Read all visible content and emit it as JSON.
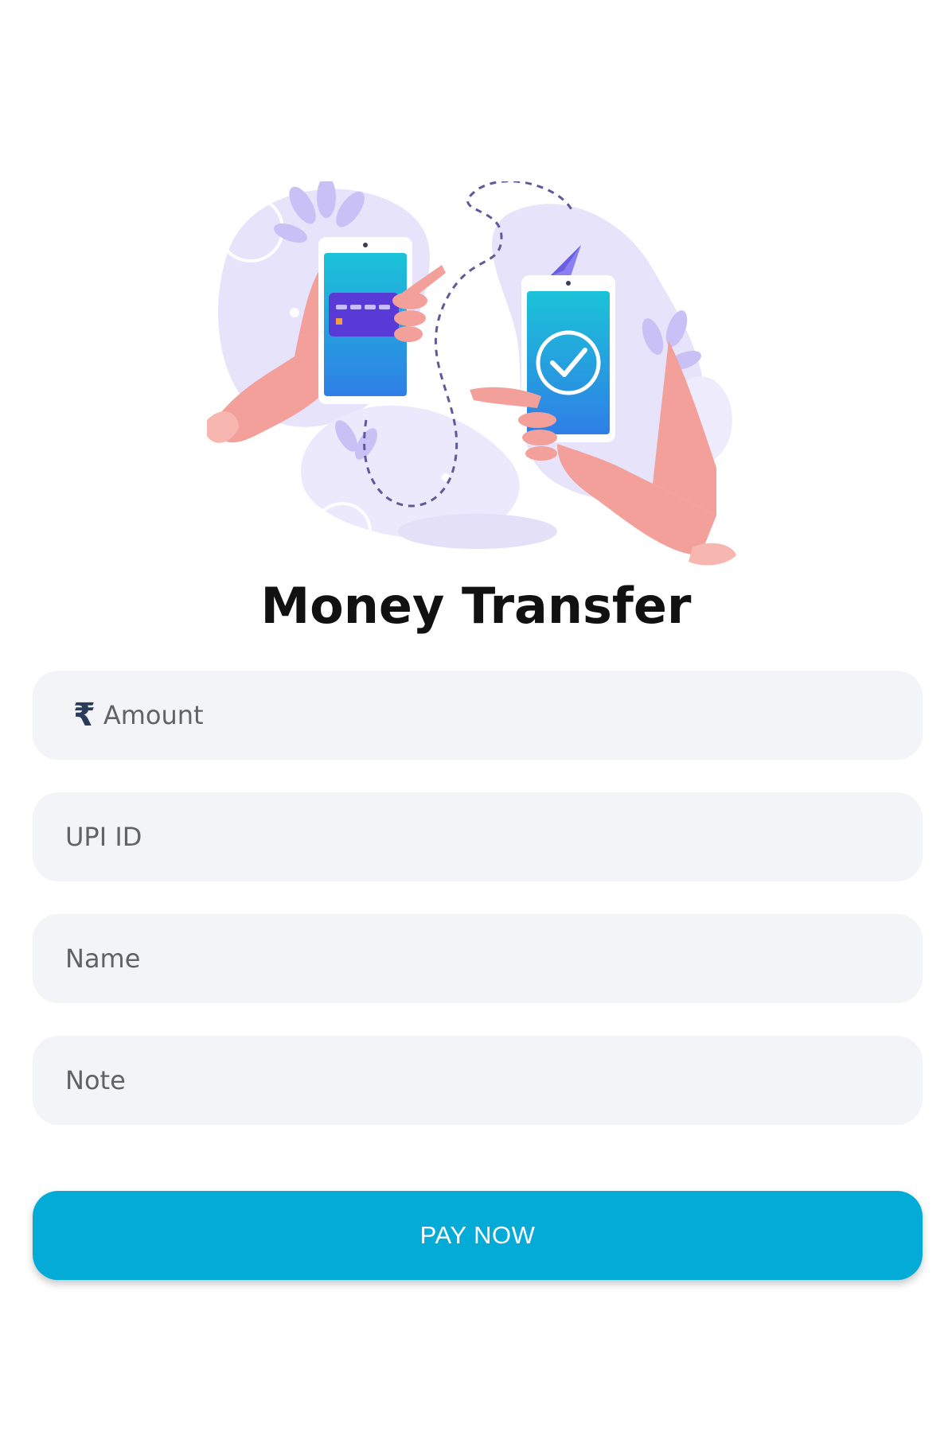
{
  "header": {
    "title": "Money Transfer"
  },
  "form": {
    "amount_placeholder": "Amount",
    "currency_symbol": "₹",
    "upi_placeholder": "UPI ID",
    "name_placeholder": "Name",
    "note_placeholder": "Note"
  },
  "actions": {
    "pay_label": "PAY NOW"
  },
  "illustration": {
    "icon": "money-transfer-illustration"
  },
  "colors": {
    "accent": "#03abd6",
    "field_bg": "#f3f4f8",
    "title": "#111111",
    "placeholder": "#5f6368"
  }
}
